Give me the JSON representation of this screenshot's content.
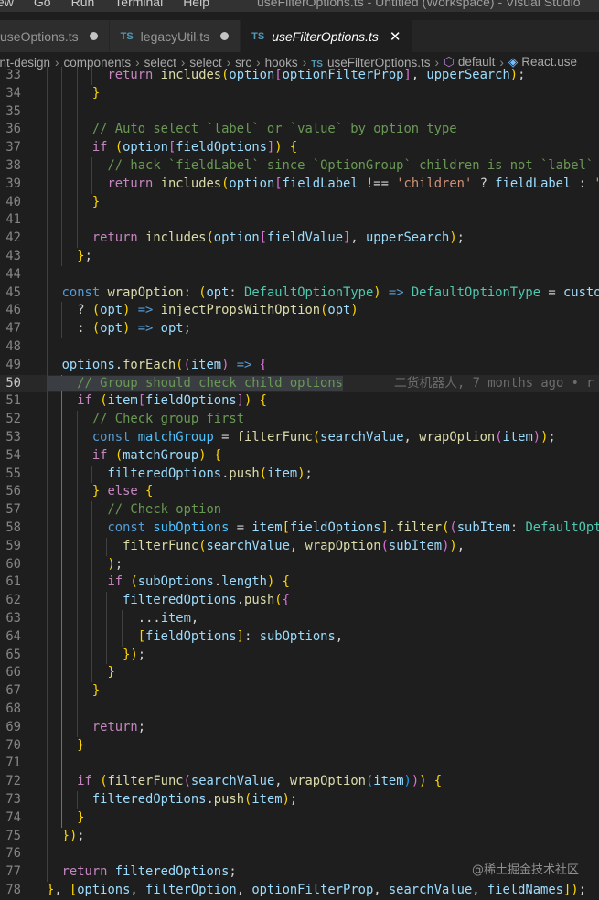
{
  "window": {
    "menu": [
      "ew",
      "Go",
      "Run",
      "Terminal",
      "Help"
    ],
    "title": "useFilterOptions.ts - Untitled (Workspace) - Visual Studio"
  },
  "tabs": [
    {
      "label": "useOptions.ts",
      "dirty": true,
      "active": false
    },
    {
      "label": "legacyUtil.ts",
      "dirty": true,
      "active": false
    },
    {
      "label": "useFilterOptions.ts",
      "dirty": false,
      "active": true
    }
  ],
  "tab_icon_text": "TS",
  "breadcrumb": [
    "ant-design",
    "components",
    "select",
    "select",
    "src",
    "hooks",
    "useFilterOptions.ts",
    "default",
    "React.use"
  ],
  "code": [
    {
      "n": 33,
      "t": "        return includes(option[optionFilterProp], upperSearch);"
    },
    {
      "n": 34,
      "t": "      }"
    },
    {
      "n": 35,
      "t": ""
    },
    {
      "n": 36,
      "t": "      // Auto select `label` or `value` by option type"
    },
    {
      "n": 37,
      "t": "      if (option[fieldOptions]) {"
    },
    {
      "n": 38,
      "t": "        // hack `fieldLabel` since `OptionGroup` children is not `label`"
    },
    {
      "n": 39,
      "t": "        return includes(option[fieldLabel !== 'children' ? fieldLabel : 'label'"
    },
    {
      "n": 40,
      "t": "      }"
    },
    {
      "n": 41,
      "t": ""
    },
    {
      "n": 42,
      "t": "      return includes(option[fieldValue], upperSearch);"
    },
    {
      "n": 43,
      "t": "    };"
    },
    {
      "n": 44,
      "t": ""
    },
    {
      "n": 45,
      "t": "  const wrapOption: (opt: DefaultOptionType) => DefaultOptionType = customizeFilter"
    },
    {
      "n": 46,
      "t": "    ? (opt) => injectPropsWithOption(opt)"
    },
    {
      "n": 47,
      "t": "    : (opt) => opt;"
    },
    {
      "n": 48,
      "t": ""
    },
    {
      "n": 49,
      "t": "  options.forEach((item) => {"
    },
    {
      "n": 50,
      "t": "    // Group should check child options"
    },
    {
      "n": 51,
      "t": "    if (item[fieldOptions]) {"
    },
    {
      "n": 52,
      "t": "      // Check group first"
    },
    {
      "n": 53,
      "t": "      const matchGroup = filterFunc(searchValue, wrapOption(item));"
    },
    {
      "n": 54,
      "t": "      if (matchGroup) {"
    },
    {
      "n": 55,
      "t": "        filteredOptions.push(item);"
    },
    {
      "n": 56,
      "t": "      } else {"
    },
    {
      "n": 57,
      "t": "        // Check option"
    },
    {
      "n": 58,
      "t": "        const subOptions = item[fieldOptions].filter((subItem: DefaultOptionType) =>"
    },
    {
      "n": 59,
      "t": "          filterFunc(searchValue, wrapOption(subItem)),"
    },
    {
      "n": 60,
      "t": "        );"
    },
    {
      "n": 61,
      "t": "        if (subOptions.length) {"
    },
    {
      "n": 62,
      "t": "          filteredOptions.push({"
    },
    {
      "n": 63,
      "t": "            ...item,"
    },
    {
      "n": 64,
      "t": "            [fieldOptions]: subOptions,"
    },
    {
      "n": 65,
      "t": "          });"
    },
    {
      "n": 66,
      "t": "        }"
    },
    {
      "n": 67,
      "t": "      }"
    },
    {
      "n": 68,
      "t": ""
    },
    {
      "n": 69,
      "t": "      return;"
    },
    {
      "n": 70,
      "t": "    }"
    },
    {
      "n": 71,
      "t": ""
    },
    {
      "n": 72,
      "t": "    if (filterFunc(searchValue, wrapOption(item))) {"
    },
    {
      "n": 73,
      "t": "      filteredOptions.push(item);"
    },
    {
      "n": 74,
      "t": "    }"
    },
    {
      "n": 75,
      "t": "  });"
    },
    {
      "n": 76,
      "t": ""
    },
    {
      "n": 77,
      "t": "  return filteredOptions;"
    },
    {
      "n": 78,
      "t": "}, [options, filterOption, optionFilterProp, searchValue, fieldNames]);"
    }
  ],
  "current_line": 50,
  "blame": "二货机器人, 7 months ago • r",
  "watermark": "@稀土掘金技术社区",
  "colors": {
    "editor_bg": "#1e1e1e",
    "tab_bg": "#2d2d2d",
    "keyword": "#569cd6",
    "control": "#c586c0",
    "function": "#dcdcaa",
    "variable": "#9cdcfe",
    "type": "#4ec9b0",
    "string": "#ce9178",
    "comment": "#6a9955"
  }
}
